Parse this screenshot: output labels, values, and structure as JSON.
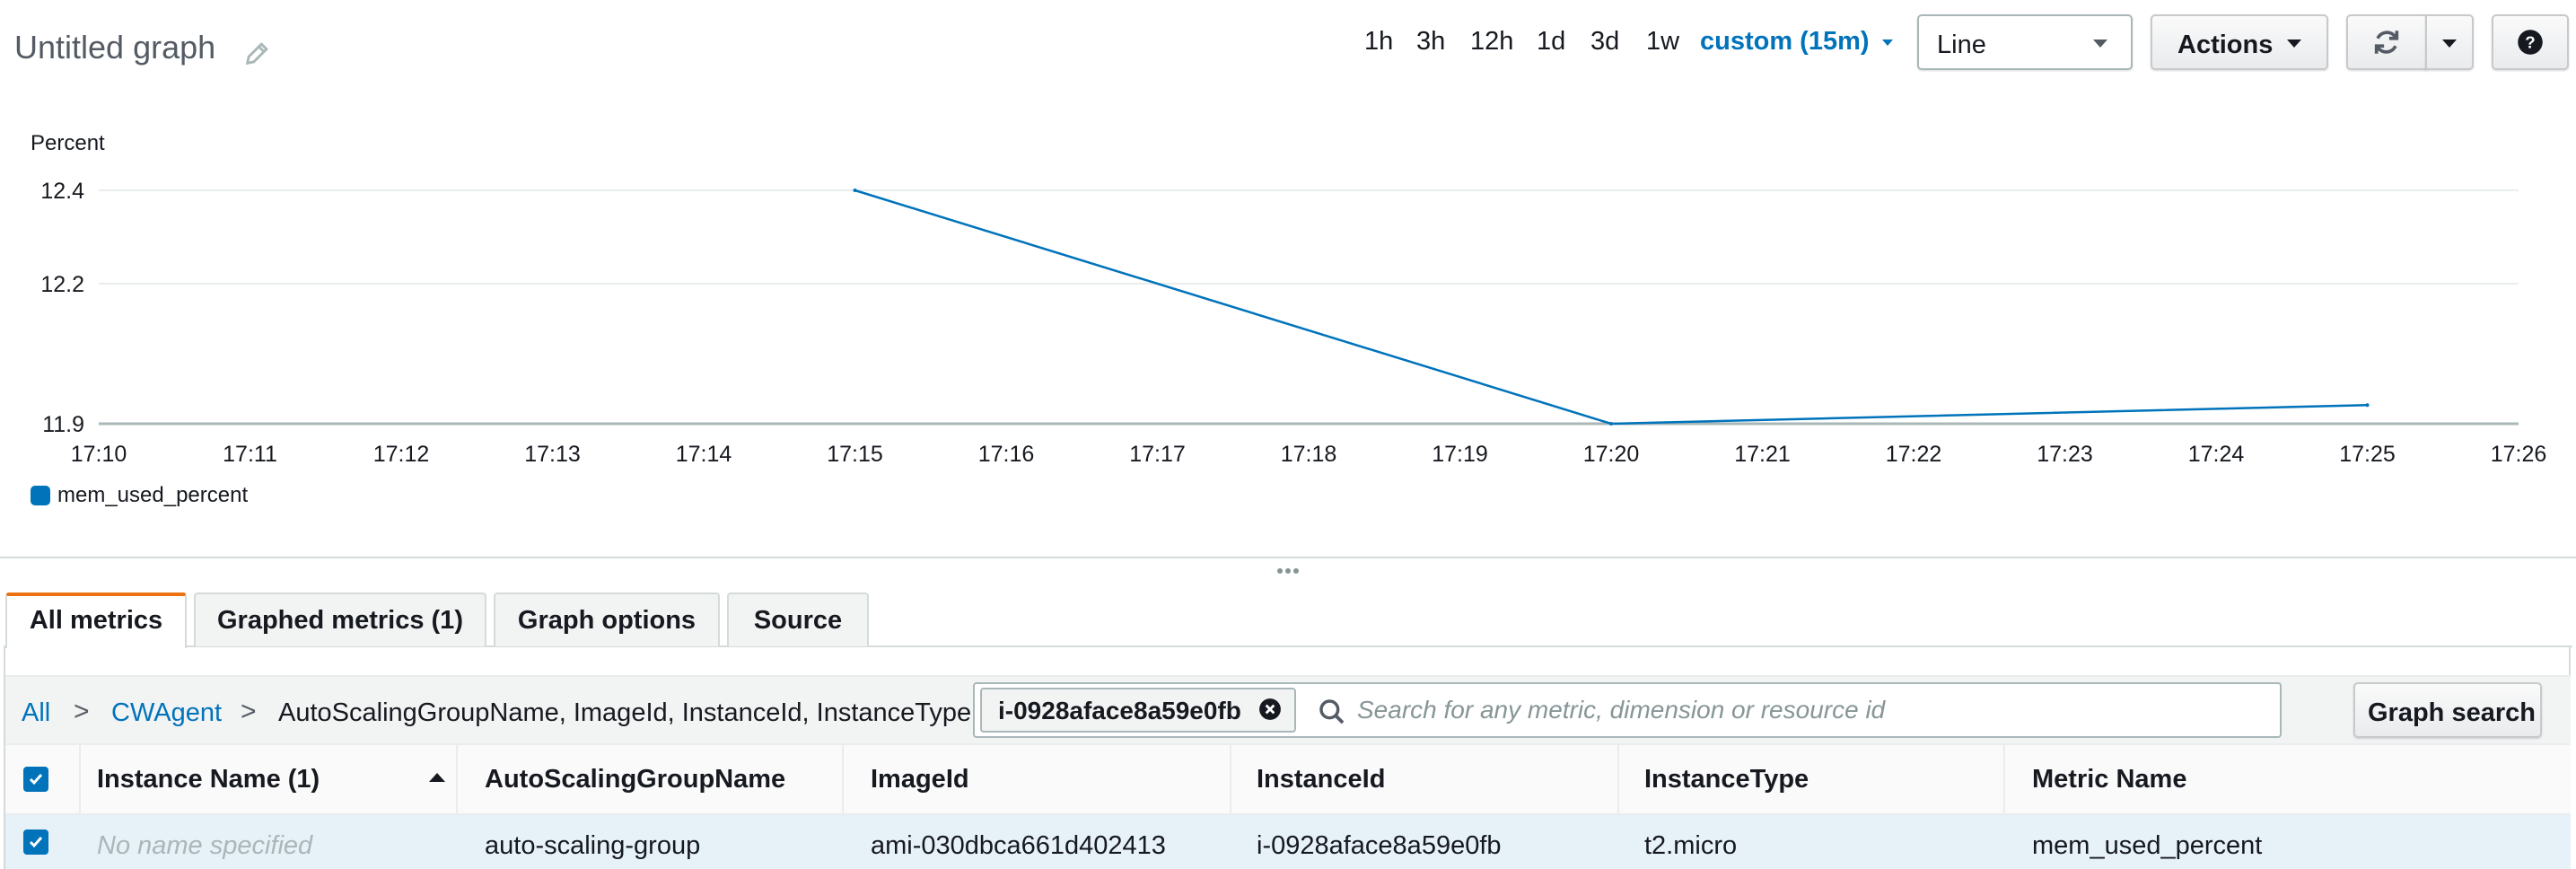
{
  "header": {
    "title": "Untitled graph",
    "ranges": [
      "1h",
      "3h",
      "12h",
      "1d",
      "3d",
      "1w"
    ],
    "custom_range": "custom (15m)",
    "view_type": "Line",
    "actions_label": "Actions"
  },
  "chart_data": {
    "type": "line",
    "title": "",
    "ylabel": "Percent",
    "xlabel": "",
    "x": [
      "17:15",
      "17:20",
      "17:25"
    ],
    "x_ticks": [
      "17:10",
      "17:11",
      "17:12",
      "17:13",
      "17:14",
      "17:15",
      "17:16",
      "17:17",
      "17:18",
      "17:19",
      "17:20",
      "17:21",
      "17:22",
      "17:23",
      "17:24",
      "17:25",
      "17:26"
    ],
    "y_ticks": [
      "12.4",
      "12.2",
      "11.9"
    ],
    "ylim": [
      11.9,
      12.4
    ],
    "series": [
      {
        "name": "mem_used_percent",
        "values": [
          12.4,
          11.9,
          11.94
        ],
        "color": "#0073bb"
      }
    ],
    "grid": true,
    "legend_position": "bottom-left"
  },
  "tabs": [
    {
      "label": "All metrics",
      "active": true
    },
    {
      "label": "Graphed metrics (1)",
      "active": false
    },
    {
      "label": "Graph options",
      "active": false
    },
    {
      "label": "Source",
      "active": false
    }
  ],
  "breadcrumb": {
    "all": "All",
    "namespace": "CWAgent",
    "separator": ">",
    "current": "AutoScalingGroupName, ImageId, InstanceId, InstanceType"
  },
  "search": {
    "token": "i-0928aface8a59e0fb",
    "placeholder": "Search for any metric, dimension or resource id",
    "button_label": "Graph search"
  },
  "table": {
    "columns": [
      "Instance Name (1)",
      "AutoScalingGroupName",
      "ImageId",
      "InstanceId",
      "InstanceType",
      "Metric Name"
    ],
    "rows": [
      [
        "No name specified",
        "auto-scaling-group",
        "ami-030dbca661d402413",
        "i-0928aface8a59e0fb",
        "t2.micro",
        "mem_used_percent"
      ]
    ]
  },
  "colors": {
    "accent": "#0073bb",
    "active_tab": "#ec7211",
    "selected_row": "#e6f1f8"
  }
}
